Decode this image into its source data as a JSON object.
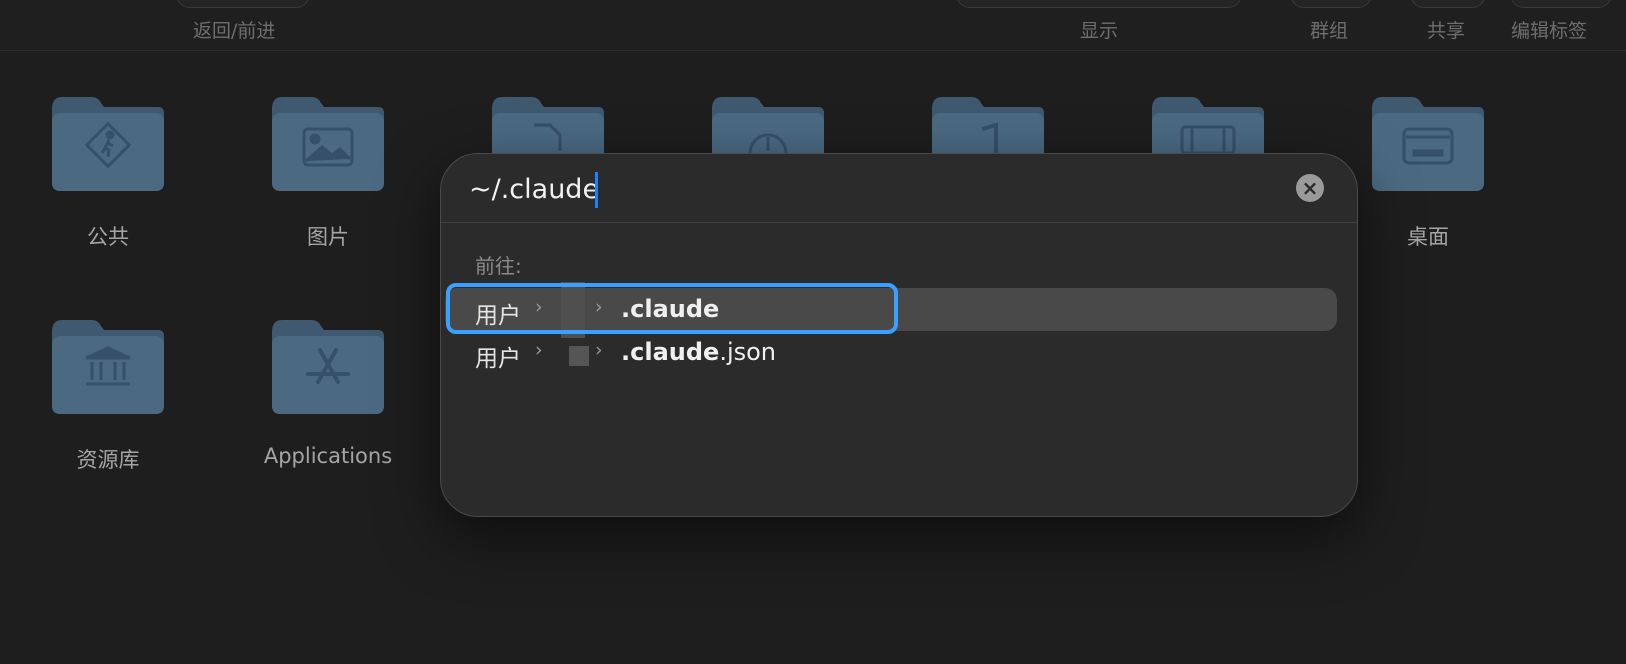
{
  "toolbar": {
    "back_forward_label": "返回/前进",
    "display_label": "显示",
    "group_label": "群组",
    "share_label": "共享",
    "edit_tags_label": "编辑标签"
  },
  "folders": [
    {
      "label": "公共",
      "icon": "public-walk-icon"
    },
    {
      "label": "图片",
      "icon": "pictures-icon"
    },
    {
      "label": "",
      "icon": "document-icon"
    },
    {
      "label": "",
      "icon": "downloads-icon"
    },
    {
      "label": "",
      "icon": "music-icon"
    },
    {
      "label": "",
      "icon": "movies-icon"
    },
    {
      "label": "桌面",
      "icon": "desktop-icon"
    },
    {
      "label": "资源库",
      "icon": "library-icon"
    },
    {
      "label": "Applications",
      "icon": "applications-icon"
    }
  ],
  "goto_dialog": {
    "path_value": "~/.claude",
    "section_label": "前往:",
    "results": [
      {
        "parent": "用户",
        "name_bold": ".claude",
        "name_rest": "",
        "selected": true
      },
      {
        "parent": "用户",
        "name_bold": ".claude",
        "name_rest": ".json",
        "selected": false
      }
    ]
  },
  "colors": {
    "background": "#1e1e1e",
    "dialog": "#2b2b2b",
    "folder": "#4b6a82",
    "focus_ring": "#3aa0ff",
    "caret": "#1a82ff"
  }
}
